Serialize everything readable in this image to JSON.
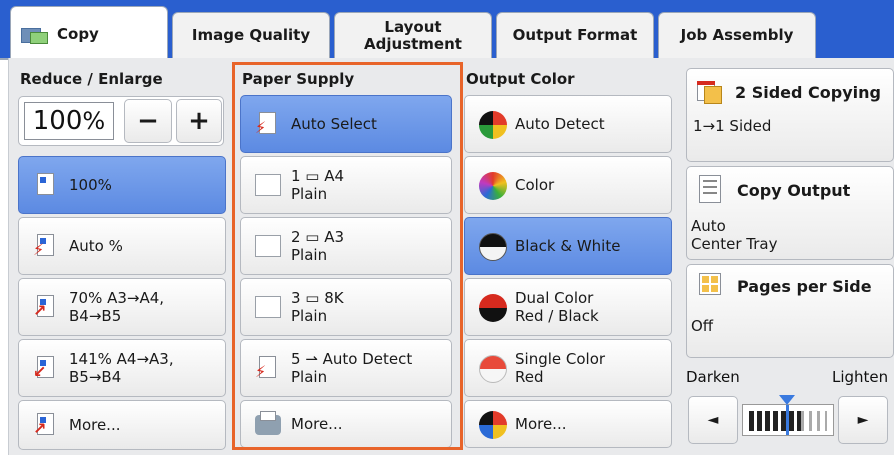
{
  "tabs": [
    {
      "label": "Copy",
      "icon": "copy-icon",
      "active": true
    },
    {
      "label": "Image Quality"
    },
    {
      "label": "Layout\nAdjustment"
    },
    {
      "label": "Output Format"
    },
    {
      "label": "Job Assembly"
    }
  ],
  "reduce_enlarge": {
    "title": "Reduce / Enlarge",
    "value": "100",
    "unit": "%",
    "minus": "−",
    "plus": "+",
    "options": [
      {
        "label": "100%"
      },
      {
        "label": "Auto %"
      },
      {
        "line1": "70% A3→A4,",
        "line2": "B4→B5"
      },
      {
        "line1": "141% A4→A3,",
        "line2": "B5→B4"
      },
      {
        "label": "More..."
      }
    ]
  },
  "paper_supply": {
    "title": "Paper Supply",
    "options": [
      {
        "label": "Auto Select"
      },
      {
        "line1": "1 ▭ A4",
        "line2": "Plain"
      },
      {
        "line1": "2 ▭ A3",
        "line2": "Plain"
      },
      {
        "line1": "3 ▭ 8K",
        "line2": "Plain"
      },
      {
        "line1": "5 ⇀ Auto Detect",
        "line2": "Plain"
      },
      {
        "label": "More..."
      }
    ]
  },
  "output_color": {
    "title": "Output Color",
    "options": [
      {
        "label": "Auto Detect"
      },
      {
        "label": "Color"
      },
      {
        "label": "Black & White"
      },
      {
        "line1": "Dual Color",
        "line2": "Red / Black"
      },
      {
        "line1": "Single Color",
        "line2": "Red"
      },
      {
        "label": "More..."
      }
    ]
  },
  "side": {
    "two_sided": {
      "title": "2 Sided Copying",
      "value": "1→1 Sided"
    },
    "copy_output": {
      "title": "Copy Output",
      "line1": "Auto",
      "line2": "Center Tray"
    },
    "pages_per_side": {
      "title": "Pages per Side",
      "value": "Off"
    },
    "darken": "Darken",
    "lighten": "Lighten",
    "left_arrow": "◄",
    "right_arrow": "►"
  },
  "colors": {
    "tab_blue": "#2a5fcf",
    "selected_blue": "#6a94e6",
    "highlight_orange": "#e8642a"
  }
}
